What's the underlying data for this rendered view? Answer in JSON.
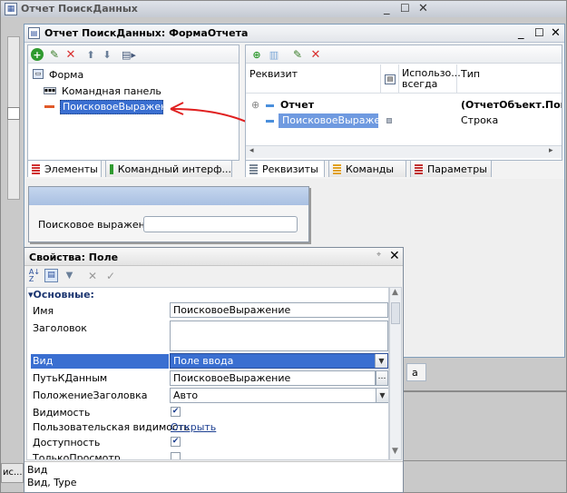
{
  "outer_window": {
    "title": "Отчет ПоискДанных"
  },
  "form_window": {
    "title": "Отчет ПоискДанных: ФормаОтчета"
  },
  "elements_tree": {
    "items": [
      {
        "label": "Форма"
      },
      {
        "label": "Командная панель"
      },
      {
        "label": "ПоисковоеВыражение"
      }
    ]
  },
  "left_tabs": [
    {
      "label": "Элементы"
    },
    {
      "label": "Командный интерф..."
    }
  ],
  "attributes_table": {
    "columns": [
      "Реквизит",
      "Использо... всегда",
      "Тип"
    ],
    "rows": [
      {
        "name": "Отчет",
        "type": "(ОтчетОбъект.Поиск"
      },
      {
        "name": "ПоисковоеВыраже...",
        "type": "Строка"
      }
    ]
  },
  "right_tabs": [
    {
      "label": "Реквизиты"
    },
    {
      "label": "Команды"
    },
    {
      "label": "Параметры"
    }
  ],
  "preview": {
    "field_label": "Поисковое выражение:"
  },
  "properties": {
    "title": "Свойства: Поле",
    "section": "Основные:",
    "rows": {
      "name": {
        "label": "Имя",
        "value": "ПоисковоеВыражение"
      },
      "caption": {
        "label": "Заголовок",
        "value": ""
      },
      "kind": {
        "label": "Вид",
        "value": "Поле ввода"
      },
      "datapath": {
        "label": "ПутьКДанным",
        "value": "ПоисковоеВыражение"
      },
      "titlepos": {
        "label": "ПоложениеЗаголовка",
        "value": "Авто"
      },
      "visible": {
        "label": "Видимость",
        "checked": true
      },
      "uservis": {
        "label": "Пользовательская видимость",
        "value": "Открыть"
      },
      "enabled": {
        "label": "Доступность",
        "checked": true
      },
      "readonly": {
        "label": "ТолькоПросмотр",
        "checked": false
      }
    },
    "description_title": "Вид",
    "description_text": "Вид, Type"
  },
  "background_fragments": {
    "bottom_left": "ис...",
    "right_tab_fragment": "а"
  },
  "colors": {
    "selection": "#3a6fd1",
    "arrow": "#e02020",
    "accent_green": "#2f9a2f",
    "accent_red": "#d93030"
  }
}
